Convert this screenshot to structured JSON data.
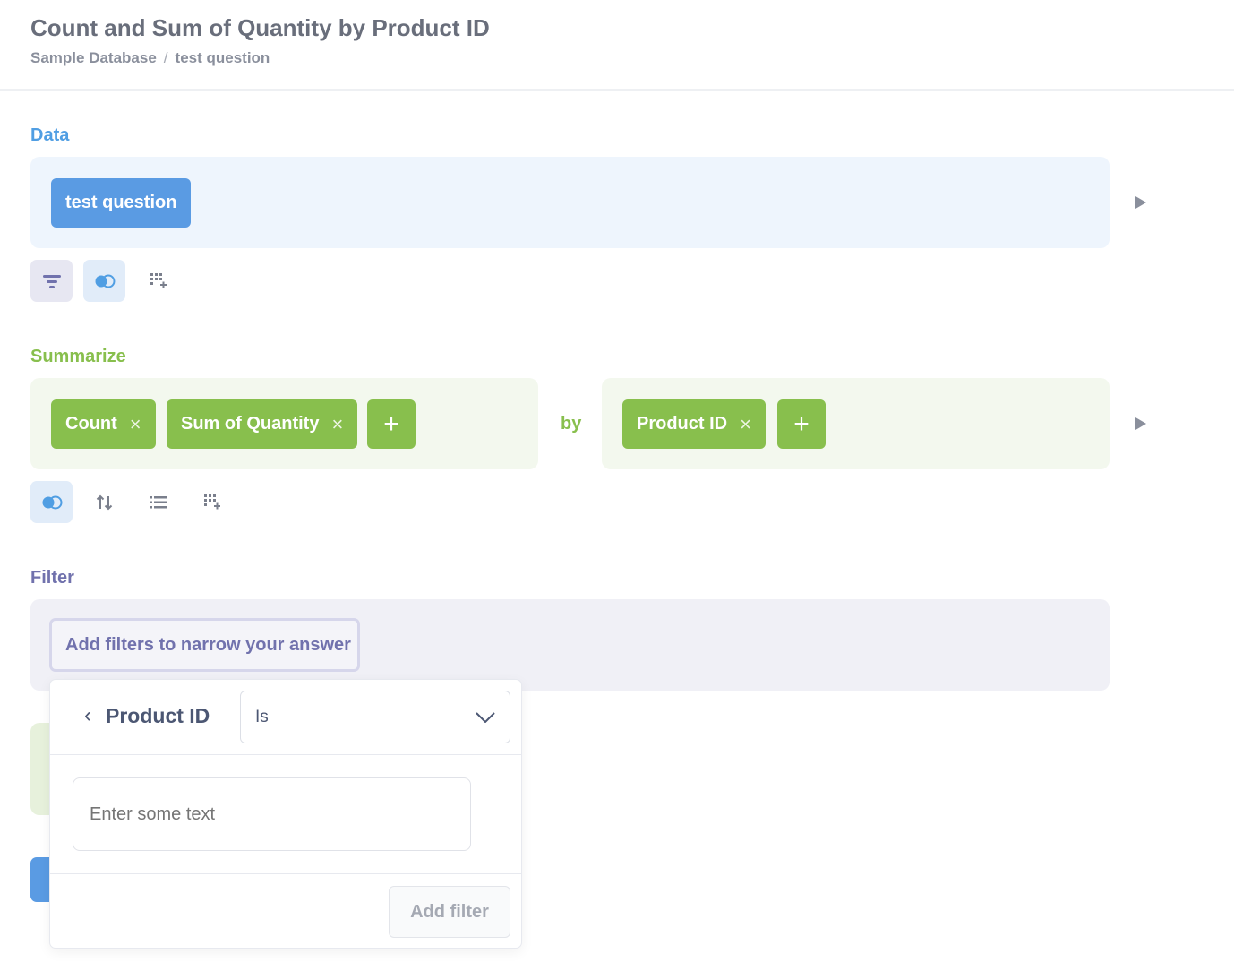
{
  "header": {
    "title": "Count and Sum of Quantity by Product ID",
    "breadcrumb": [
      "Sample Database",
      "test question"
    ],
    "breadcrumb_separator": "/"
  },
  "data_section": {
    "label": "Data",
    "source": "test question",
    "tools": [
      {
        "name": "filter-icon",
        "active": true
      },
      {
        "name": "join-icon",
        "active": true
      },
      {
        "name": "custom-column-icon",
        "active": false
      }
    ]
  },
  "summarize_section": {
    "label": "Summarize",
    "metrics": [
      {
        "label": "Count",
        "remove": "×"
      },
      {
        "label": "Sum of Quantity",
        "remove": "×"
      }
    ],
    "add_metric": "+",
    "by_label": "by",
    "breakouts": [
      {
        "label": "Product ID",
        "remove": "×"
      }
    ],
    "add_breakout": "+",
    "tools": [
      {
        "name": "join-icon",
        "active": true
      },
      {
        "name": "sort-icon",
        "active": false
      },
      {
        "name": "list-icon",
        "active": false
      },
      {
        "name": "custom-column-icon",
        "active": false
      }
    ]
  },
  "filter_section": {
    "label": "Filter",
    "placeholder_button": "Add filters to narrow your answer"
  },
  "filter_popover": {
    "back_glyph": "‹",
    "field_name": "Product ID",
    "operator": "Is",
    "input_placeholder": "Enter some text",
    "submit_label": "Add filter"
  },
  "colors": {
    "data_accent": "#509ee3",
    "summarize_accent": "#88bf4d",
    "filter_accent": "#7172ad"
  }
}
